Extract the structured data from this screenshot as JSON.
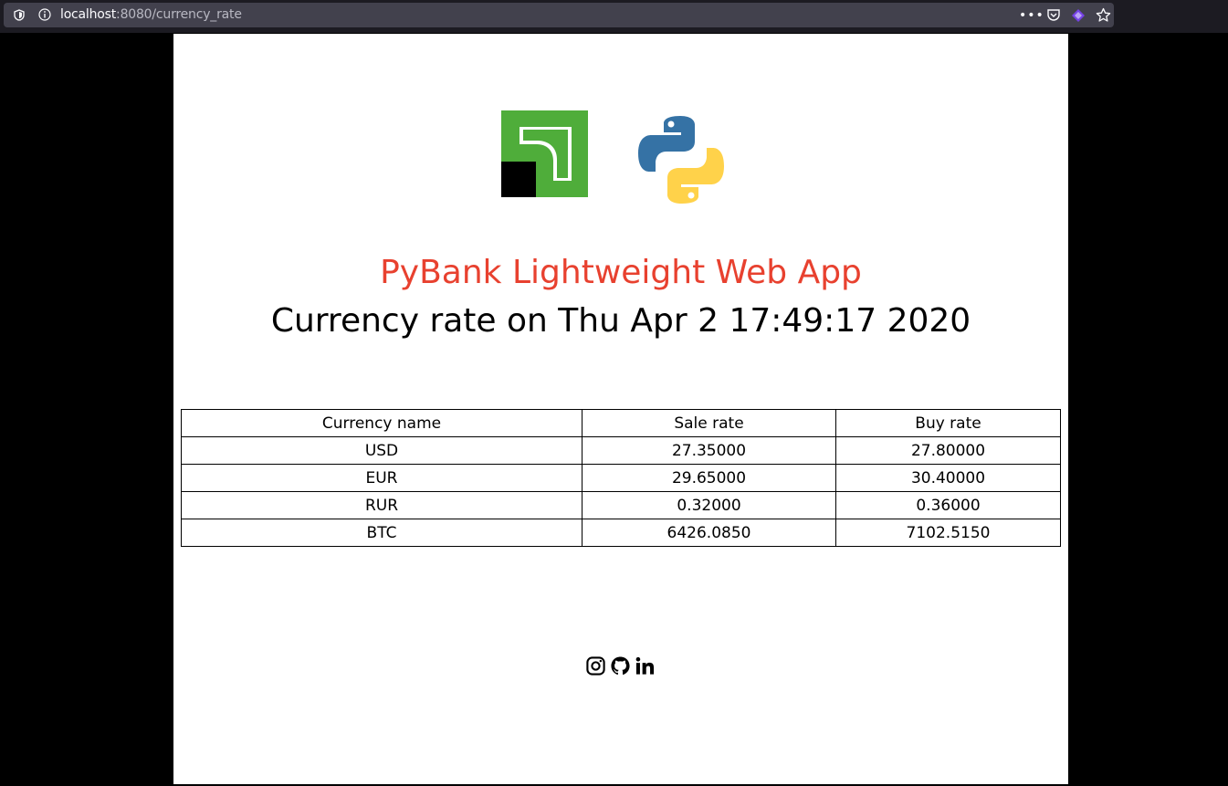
{
  "browser": {
    "url_host": "localhost",
    "url_path": ":8080/currency_rate",
    "more_label": "•••"
  },
  "header": {
    "title": "PyBank Lightweight Web App",
    "subtitle": "Currency rate on Thu Apr 2 17:49:17 2020"
  },
  "table": {
    "headers": [
      "Currency name",
      "Sale rate",
      "Buy rate"
    ],
    "rows": [
      [
        "USD",
        "27.35000",
        "27.80000"
      ],
      [
        "EUR",
        "29.65000",
        "30.40000"
      ],
      [
        "RUR",
        "0.32000",
        "0.36000"
      ],
      [
        "BTC",
        "6426.0850",
        "7102.5150"
      ]
    ]
  },
  "colors": {
    "title": "#e8412f",
    "privat_green": "#4fad3a",
    "python_blue": "#3572a5",
    "python_yellow": "#ffd24a"
  },
  "icons": {
    "social": [
      "instagram-icon",
      "github-icon",
      "linkedin-icon"
    ],
    "logos": [
      "privatbank-logo",
      "python-logo"
    ]
  }
}
